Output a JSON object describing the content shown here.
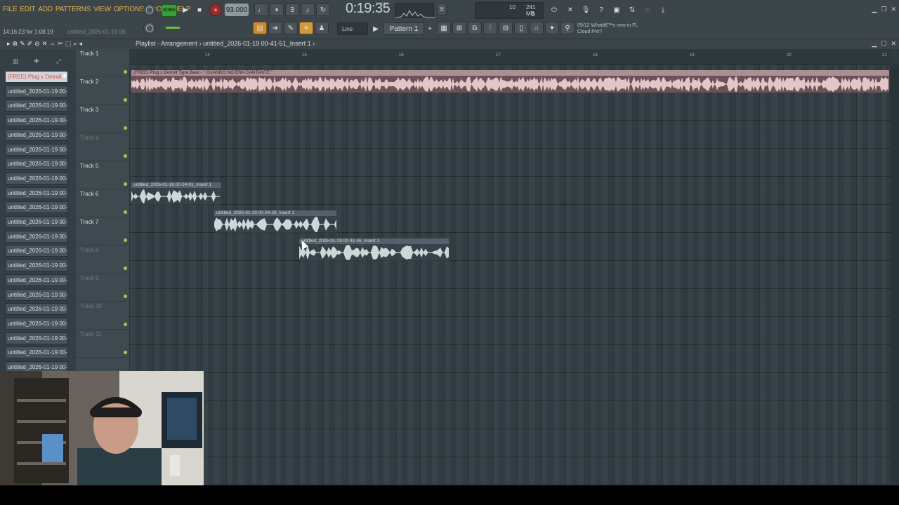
{
  "menu": [
    "FILE",
    "EDIT",
    "ADD",
    "PATTERNS",
    "VIEW",
    "OPTIONS",
    "TOOLS",
    "HELP"
  ],
  "transport": {
    "song_mode": "SONG",
    "tempo": "93.000",
    "time": "0:19:35",
    "time_unit": "M:S:CS"
  },
  "cpu": {
    "value": "10",
    "memory": "241 MB",
    "poly": "0"
  },
  "hint": {
    "main": "14:16:23 for 1:08:19",
    "sub": "untitled_2026-01-19 00-"
  },
  "snap": "Line",
  "pattern_selector": "Pattern 1",
  "news": {
    "date": "09/12",
    "text": "Whatâ€™s new in FL Cloud Pro?"
  },
  "playlist": {
    "breadcrumb": "Playlist - Arrangement",
    "pattern_name": "untitled_2026-01-19 00-41-51_Insert 1",
    "breadcrumb_end": "›"
  },
  "patterns": [
    "(FREE) Plug x Detroit",
    "untitled_2026-01-19 00-",
    "untitled_2026-01-19 00-",
    "untitled_2026-01-19 00-",
    "untitled_2026-01-19 00-",
    "untitled_2026-01-19 00-",
    "untitled_2026-01-19 00-",
    "untitled_2026-01-19 00-",
    "untitled_2026-01-19 00-",
    "untitled_2026-01-19 00-",
    "untitled_2026-01-19 00-",
    "untitled_2026-01-19 00-",
    "untitled_2026-01-19 00-",
    "untitled_2026-01-19 00-",
    "untitled_2026-01-19 00-",
    "untitled_2026-01-19 00-",
    "untitled_2026-01-19 00-",
    "untitled_2026-01-19 00-",
    "untitled_2026-01-19 00-",
    "untitled_2026-01-19 00-",
    "untitled_2026-01-19 00-"
  ],
  "tracks": [
    {
      "name": "Track 1",
      "dim": false
    },
    {
      "name": "Track 2",
      "dim": false
    },
    {
      "name": "Track 3",
      "dim": false
    },
    {
      "name": "Track 4",
      "dim": true
    },
    {
      "name": "Track 5",
      "dim": false
    },
    {
      "name": "Track 6",
      "dim": false
    },
    {
      "name": "Track 7",
      "dim": false
    },
    {
      "name": "Track 8",
      "dim": true
    },
    {
      "name": "Track 9",
      "dim": true
    },
    {
      "name": "Track 10",
      "dim": true
    },
    {
      "name": "Track 11",
      "dim": true
    }
  ],
  "timeline_bars": [
    "14",
    "15",
    "16",
    "17",
    "18",
    "19",
    "20",
    "21"
  ],
  "clips": {
    "beat": "(FREE) Plug x Detroit Type Beat - \" CUANDO NO ERA CANTANTE \"",
    "vocal1": "untitled_2026-01-19 00-24-01_Insert 1",
    "vocal2": "untitled_2026-01-19 00-24-29_Insert 1",
    "vocal3": "untitled_2026-01-19 00-41-46_Insert 1"
  }
}
